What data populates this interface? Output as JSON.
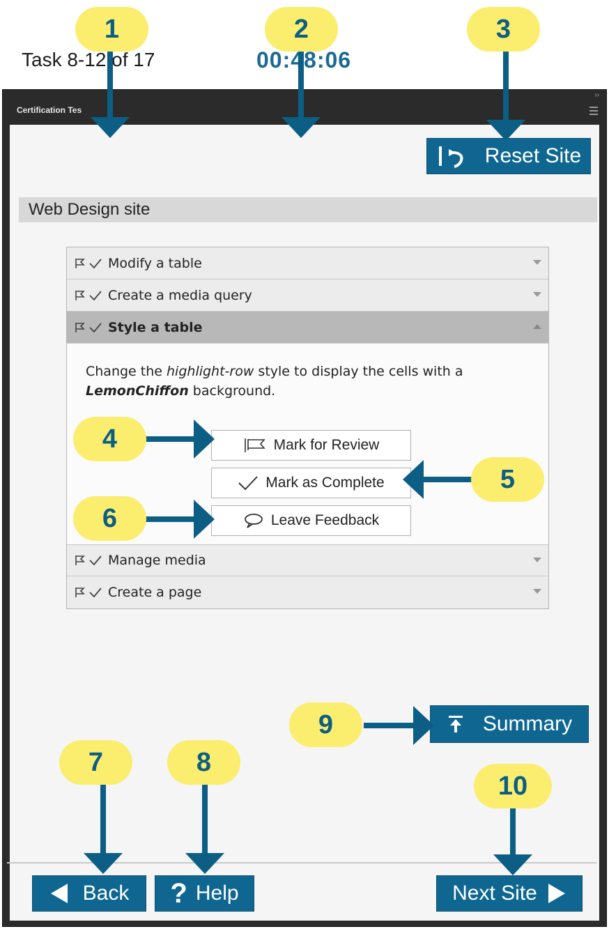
{
  "window": {
    "title": "Certification Tes"
  },
  "header": {
    "task_counter": "Task 8-12 of 17",
    "timer": "00:48:06",
    "reset_label": "Reset Site"
  },
  "site": {
    "name": "Web Design site"
  },
  "tasks": [
    {
      "label": "Modify a table",
      "expanded": false
    },
    {
      "label": "Create a media query",
      "expanded": false
    },
    {
      "label": "Style a table",
      "expanded": true
    },
    {
      "label": "Manage media",
      "expanded": false
    },
    {
      "label": "Create a page",
      "expanded": false
    }
  ],
  "task_detail": {
    "pre": "Change the ",
    "style_name": "highlight-row",
    "mid": " style to display the cells with a ",
    "color_name": "LemonChiffon",
    "post": " background.",
    "mark_review_label": "Mark for Review",
    "mark_complete_label": "Mark as Complete",
    "feedback_label": "Leave Feedback"
  },
  "footer": {
    "summary_label": "Summary",
    "back_label": "Back",
    "help_label": "Help",
    "next_label": "Next Site"
  },
  "callouts": [
    "1",
    "2",
    "3",
    "4",
    "5",
    "6",
    "7",
    "8",
    "9",
    "10"
  ],
  "colors": {
    "accent": "#0f6791",
    "callout_fill": "#fbed6e",
    "callout_text": "#0c5e84",
    "timer": "#1a6a93",
    "titlebar": "#2b2b2b"
  },
  "icons": [
    "flag-icon",
    "check-icon",
    "speech-bubble-icon",
    "reset-icon",
    "summary-icon",
    "back-arrow-icon",
    "help-icon",
    "next-arrow-icon"
  ]
}
